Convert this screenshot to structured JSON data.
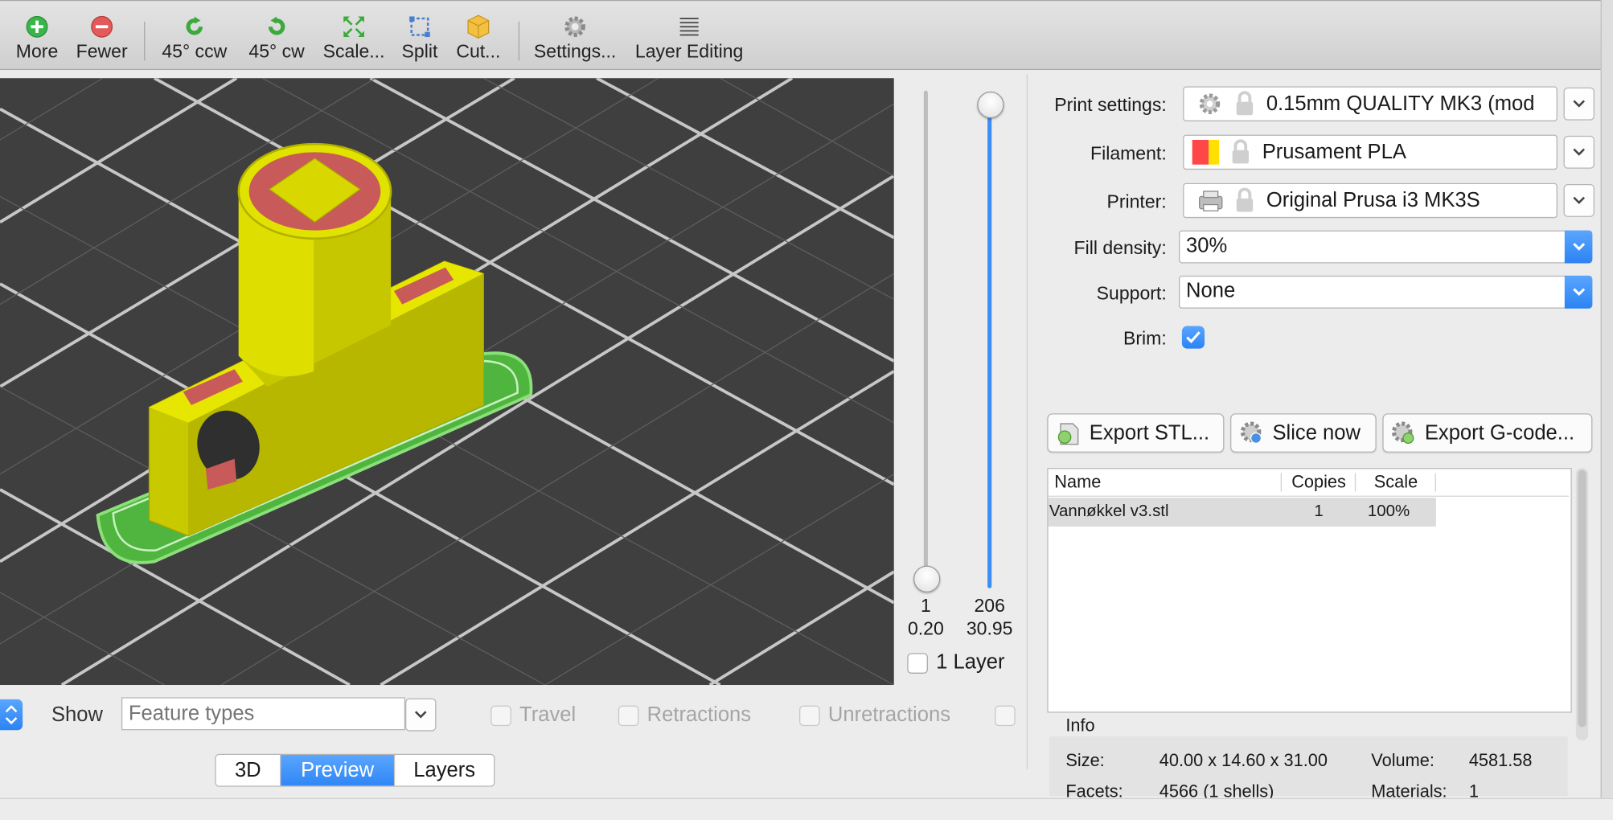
{
  "toolbar": {
    "buttons": [
      {
        "label": "More"
      },
      {
        "label": "Fewer"
      },
      {
        "label": "45° ccw"
      },
      {
        "label": "45° cw"
      },
      {
        "label": "Scale..."
      },
      {
        "label": "Split"
      },
      {
        "label": "Cut..."
      },
      {
        "label": "Settings..."
      },
      {
        "label": "Layer Editing"
      }
    ]
  },
  "slider": {
    "bottom_layer": "1",
    "bottom_height": "0.20",
    "top_layer": "206",
    "top_height": "30.95",
    "one_layer_label": "1 Layer",
    "one_layer_checked": false
  },
  "preview_bar": {
    "show_label": "Show",
    "feature_placeholder": "Feature types",
    "travel_label": "Travel",
    "retractions_label": "Retractions",
    "unretractions_label": "Unretractions"
  },
  "view_tabs": [
    {
      "label": "3D",
      "active": false
    },
    {
      "label": "Preview",
      "active": true
    },
    {
      "label": "Layers",
      "active": false
    }
  ],
  "settings": {
    "print_label": "Print settings:",
    "print_value": "0.15mm QUALITY MK3 (mod",
    "filament_label": "Filament:",
    "filament_value": "Prusament PLA",
    "filament_colors": [
      "#ff4747",
      "#ffe000"
    ],
    "printer_label": "Printer:",
    "printer_value": "Original Prusa i3 MK3S",
    "fill_label": "Fill density:",
    "fill_value": "30%",
    "support_label": "Support:",
    "support_value": "None",
    "brim_label": "Brim:",
    "brim_checked": true
  },
  "actions": {
    "export_stl": "Export STL...",
    "slice_now": "Slice now",
    "export_gcode": "Export G-code..."
  },
  "object_list": {
    "headers": [
      "Name",
      "Copies",
      "Scale"
    ],
    "rows": [
      {
        "name": "Vannøkkel v3.stl",
        "copies": "1",
        "scale": "100%"
      }
    ]
  },
  "info": {
    "title": "Info",
    "size_label": "Size:",
    "size_value": "40.00 x 14.60 x 31.00",
    "volume_label": "Volume:",
    "volume_value": "4581.58",
    "facets_label": "Facets:",
    "facets_value": "4566 (1 shells)",
    "materials_label": "Materials:",
    "materials_value": "1"
  },
  "colors": {
    "accent": "#2f86f5",
    "viewport_bg": "#3f3f3f",
    "object_yellow": "#d9d900",
    "brim_green": "#5cc84a",
    "infill_red": "#d05050"
  }
}
